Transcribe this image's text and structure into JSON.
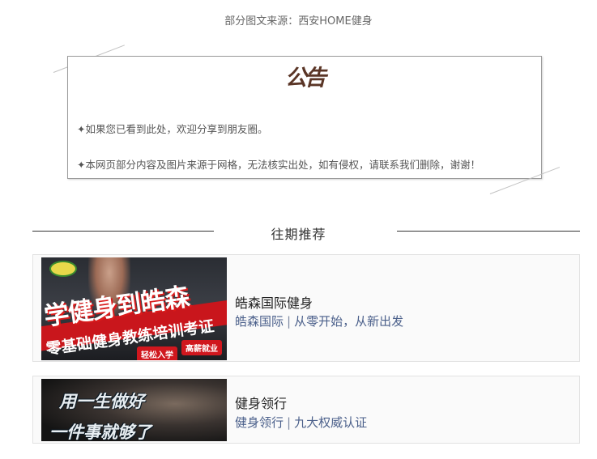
{
  "source_line": "部分图文来源：西安HOME健身",
  "notice": {
    "title": "公告",
    "lines": [
      "✦如果您已看到此处，欢迎分享到朋友圈。",
      "✦本网页部分内容及图片来源于网格，无法核实出处，如有侵权，请联系我们删除，谢谢！"
    ]
  },
  "section": {
    "title": "往期推荐"
  },
  "cards": [
    {
      "title": "皓森国际健身",
      "subtitle_left": "皓森国际",
      "separator": "|",
      "subtitle_right": "从零开始，从新出发",
      "thumb": {
        "headline": "学健身到皓森",
        "subline": "零基础健身教练培训考证",
        "tag_left": "轻松入学",
        "tag_right": "高薪就业"
      }
    },
    {
      "title": "健身领行",
      "subtitle_left": "健身领行",
      "separator": "|",
      "subtitle_right": "九大权威认证",
      "thumb": {
        "line1": "用一生做好",
        "line2": "一件事就够了"
      }
    }
  ]
}
